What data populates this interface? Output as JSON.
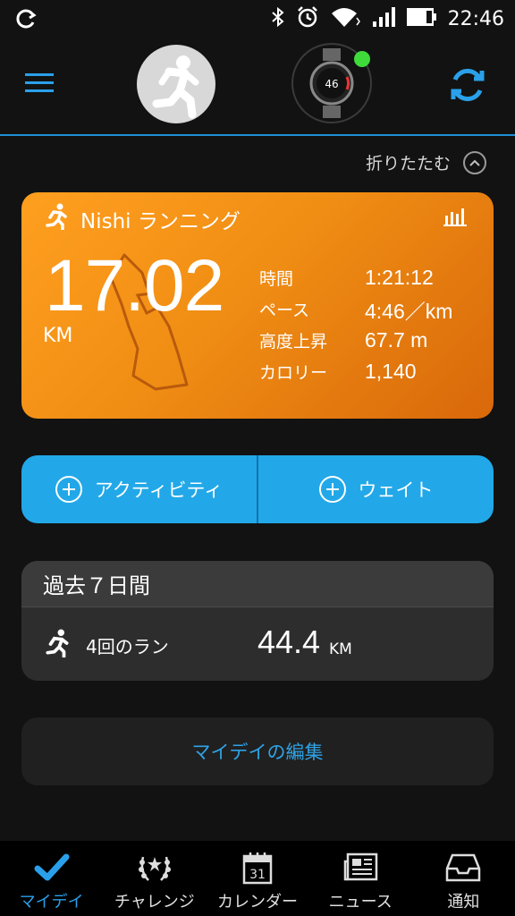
{
  "status_bar": {
    "time": "22:46"
  },
  "header": {
    "menu_icon": "hamburger-icon",
    "sync_icon": "sync-icon",
    "watch_face_value": "46"
  },
  "collapse_label": "折りたたむ",
  "activity": {
    "title": "Nishi ランニング",
    "distance": "17.02",
    "distance_unit": "KM",
    "stats": [
      {
        "label": "時間",
        "value": "1:21:12"
      },
      {
        "label": "ペース",
        "value": "4:46／km"
      },
      {
        "label": "高度上昇",
        "value": "67.7 m"
      },
      {
        "label": "カロリー",
        "value": "1,140"
      }
    ]
  },
  "add_buttons": {
    "activity_label": "アクティビティ",
    "weight_label": "ウェイト"
  },
  "last7": {
    "title": "過去７日間",
    "runs_label": "4回のラン",
    "total": "44.4",
    "total_unit": "KM"
  },
  "edit_label": "マイデイの編集",
  "tabs": [
    {
      "label": "マイデイ",
      "icon": "check-icon"
    },
    {
      "label": "チャレンジ",
      "icon": "laurel-icon"
    },
    {
      "label": "カレンダー",
      "icon": "calendar-icon",
      "calendar_day": "31"
    },
    {
      "label": "ニュース",
      "icon": "newspaper-icon"
    },
    {
      "label": "通知",
      "icon": "inbox-icon"
    }
  ],
  "colors": {
    "accent_blue": "#22a8e8",
    "activity_orange": "#f08e14",
    "device_online": "#3fdb3a"
  }
}
